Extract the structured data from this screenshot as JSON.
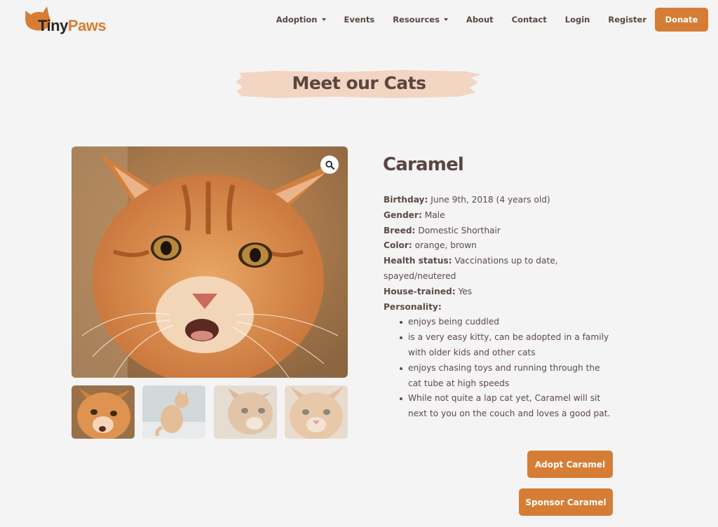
{
  "brand": {
    "name_part1": "Tiny",
    "name_part2": "Paws",
    "color": "#d67d35"
  },
  "nav": {
    "items": [
      {
        "label": "Adoption",
        "dropdown": true
      },
      {
        "label": "Events",
        "dropdown": false
      },
      {
        "label": "Resources",
        "dropdown": true
      },
      {
        "label": "About",
        "dropdown": false
      },
      {
        "label": "Contact",
        "dropdown": false
      },
      {
        "label": "Login",
        "dropdown": false
      },
      {
        "label": "Register",
        "dropdown": false
      }
    ],
    "donate_label": "Donate"
  },
  "page": {
    "title": "Meet our Cats"
  },
  "cat": {
    "name": "Caramel",
    "fields": {
      "birthday_label": "Birthday:",
      "birthday": "June 9th, 2018 (4 years old)",
      "gender_label": "Gender:",
      "gender": "Male",
      "breed_label": "Breed:",
      "breed": "Domestic Shorthair",
      "color_label": "Color:",
      "color": "orange, brown",
      "health_label": "Health status:",
      "health": "Vaccinations up to date, spayed/neutered",
      "house_label": "House-trained:",
      "house": "Yes",
      "personality_label": "Personality:"
    },
    "personality": [
      "enjoys being cuddled",
      "is a very easy kitty, can be adopted in a family with older kids and other cats",
      "enjoys chasing toys and running through the cat tube at high speeds",
      "While not quite a lap cat yet, Caramel will sit next to you on the couch and loves a good pat."
    ],
    "adopt_label": "Adopt Caramel",
    "sponsor_label": "Sponsor Caramel"
  },
  "gallery": {
    "icons": {
      "zoom": "magnifier-icon"
    },
    "thumbnail_count": 4
  },
  "colors": {
    "accent": "#d67d35",
    "text": "#5c4a45",
    "background": "#f4f4f5",
    "brush": "#f2d5c2"
  }
}
